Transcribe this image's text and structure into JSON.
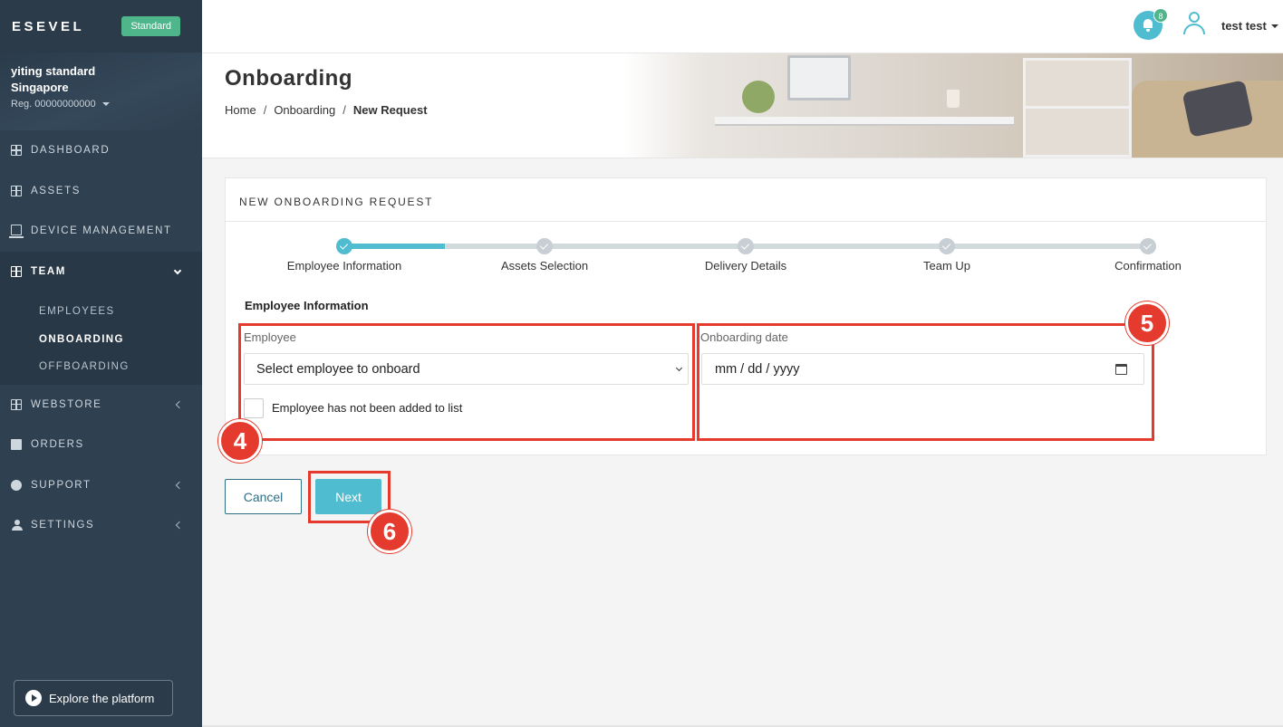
{
  "brand": {
    "name": "ESEVEL",
    "plan": "Standard"
  },
  "account": {
    "name_line1": "yiting standard",
    "name_line2": "Singapore",
    "reg": "Reg. 00000000000"
  },
  "nav": {
    "dashboard": "DASHBOARD",
    "assets": "ASSETS",
    "device_management": "DEVICE MANAGEMENT",
    "team": "TEAM",
    "employees": "EMPLOYEES",
    "onboarding": "ONBOARDING",
    "offboarding": "OFFBOARDING",
    "webstore": "WEBSTORE",
    "orders": "ORDERS",
    "support": "SUPPORT",
    "settings": "SETTINGS"
  },
  "explore": {
    "label": "Explore the platform"
  },
  "topbar": {
    "notification_count": "8",
    "user_name": "test test"
  },
  "page": {
    "title": "Onboarding",
    "breadcrumb": {
      "home": "Home",
      "sep": "/",
      "section": "Onboarding",
      "current": "New Request"
    }
  },
  "card": {
    "title": "NEW ONBOARDING REQUEST",
    "progress": 0.125,
    "steps": [
      "Employee Information",
      "Assets Selection",
      "Delivery Details",
      "Team Up",
      "Confirmation"
    ],
    "section_heading": "Employee Information",
    "employee_label": "Employee",
    "employee_select_value": "Select employee to onboard",
    "checkbox_label": "Employee has not been added to list",
    "date_label": "Onboarding date",
    "date_placeholder": "mm / dd / yyyy"
  },
  "buttons": {
    "cancel": "Cancel",
    "next": "Next"
  },
  "annotations": {
    "marker_4": "4",
    "marker_5": "5",
    "marker_6": "6",
    "color": "#e53b2e"
  },
  "colors": {
    "accent": "#4fbcd0",
    "sidebar": "#2f4050",
    "badge": "#4fb58a"
  }
}
